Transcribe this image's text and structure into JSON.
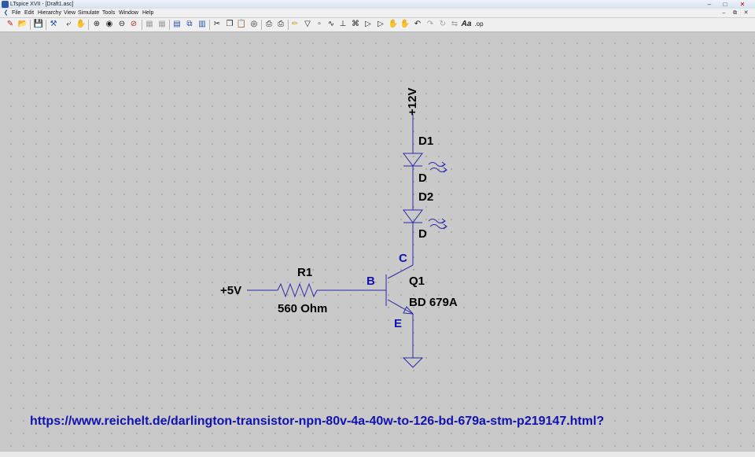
{
  "window": {
    "title": "LTspice XVII - [Draft1.asc]"
  },
  "menu": [
    "File",
    "Edit",
    "Hierarchy",
    "View",
    "Simulate",
    "Tools",
    "Window",
    "Help"
  ],
  "toolbar_icons": [
    "new-schematic-icon",
    "open-icon",
    "save-icon",
    "control-panel-icon",
    "run-icon",
    "halt-icon",
    "zoom-in-icon",
    "pan-icon",
    "zoom-out-icon",
    "zoom-fit-icon",
    "zoom-cancel-icon",
    "autorange-icon",
    "tile-horizontal-icon",
    "cascade-icon",
    "tile-vertical-icon",
    "cut-icon",
    "copy-icon",
    "paste-icon",
    "find-icon",
    "print-setup-icon",
    "print-icon",
    "wire-icon",
    "ground-icon",
    "label-net-icon",
    "resistor-icon",
    "capacitor-icon",
    "inductor-icon",
    "diode-icon",
    "component-icon",
    "move-icon",
    "drag-icon",
    "undo-icon",
    "redo-icon",
    "rotate-icon",
    "mirror-icon",
    "text-icon",
    "spice-directive-icon"
  ],
  "schematic": {
    "supply_top": "+12V",
    "d1": {
      "name": "D1",
      "model": "D"
    },
    "d2": {
      "name": "D2",
      "model": "D"
    },
    "r1": {
      "name": "R1",
      "value": "560 Ohm"
    },
    "input_label": "+5V",
    "q1": {
      "name": "Q1",
      "model": "BD 679A",
      "pin_b": "B",
      "pin_c": "C",
      "pin_e": "E"
    }
  },
  "annotation_url": "https://www.reichelt.de/darlington-transistor-npn-80v-4a-40w-to-126-bd-679a-stm-p219147.html?",
  "colors": {
    "wire": "#2a2aa8",
    "pin_label": "#1212b0",
    "canvas": "#c9c9c9"
  }
}
